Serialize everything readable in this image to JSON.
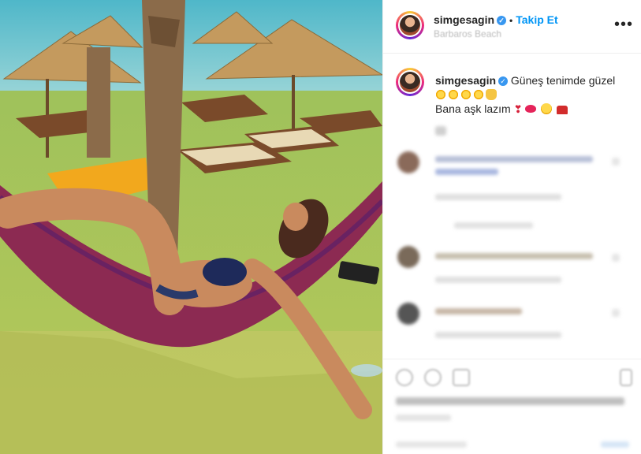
{
  "post": {
    "username": "simgesagin",
    "follow_label": "Takip Et",
    "dot": "•",
    "location": "Barbaros Beach",
    "caption_line1": "Güneş tenimde güzel",
    "caption_line2": "Bana aşk lazım"
  },
  "more_label": "•••",
  "verified_mark": "✓",
  "colors": {
    "accent": "#0095f6",
    "verified": "#3897f0",
    "text": "#262626"
  },
  "icons": [
    "verified-badge-icon",
    "more-options-icon",
    "like-icon",
    "comment-icon",
    "share-icon",
    "save-icon"
  ]
}
